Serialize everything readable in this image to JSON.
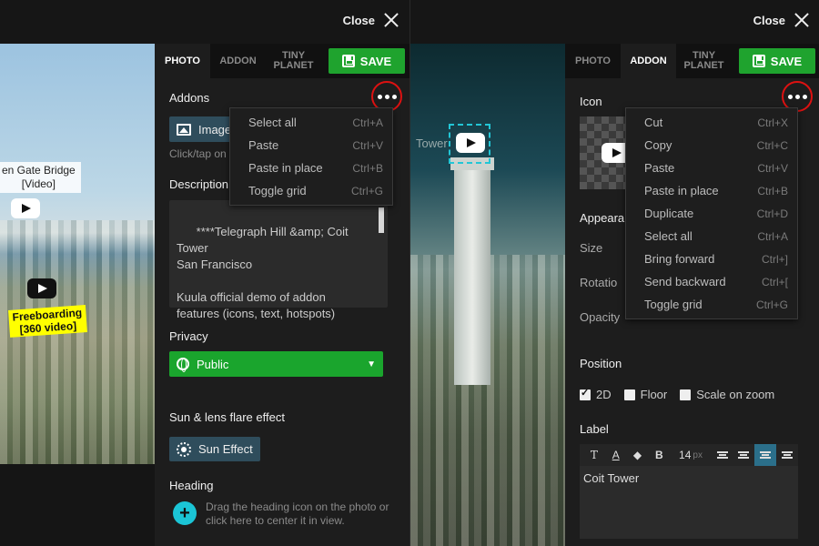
{
  "common": {
    "close_label": "Close",
    "save_label": "SAVE",
    "tabs": [
      "PHOTO",
      "ADDON",
      "TINY PLANET"
    ]
  },
  "left": {
    "photo": {
      "label_bridge": "en Gate Bridge\n[Video]",
      "label_freeboarding": "Freeboarding\n[360 video]"
    },
    "panel": {
      "addons_title": "Addons",
      "image_button": "Image",
      "addons_hint": "Click/tap on",
      "description_title": "Description",
      "description_text": "****Telegraph Hill &amp; Coit Tower\nSan Francisco\n\nKuula official demo of addon\nfeatures (icons, text, hotspots)",
      "privacy_title": "Privacy",
      "privacy_value": "Public",
      "sun_title": "Sun & lens flare effect",
      "sun_button": "Sun Effect",
      "heading_title": "Heading",
      "heading_hint": "Drag the heading icon on the photo or click here to center it in view."
    },
    "menu": [
      {
        "label": "Select all",
        "shortcut": "Ctrl+A"
      },
      {
        "label": "Paste",
        "shortcut": "Ctrl+V"
      },
      {
        "label": "Paste in place",
        "shortcut": "Ctrl+B"
      },
      {
        "label": "Toggle grid",
        "shortcut": "Ctrl+G"
      }
    ]
  },
  "right": {
    "photo": {
      "label_tower": "Tower"
    },
    "panel": {
      "icon_title": "Icon",
      "appearance_title": "Appeara",
      "size_label": "Size",
      "rotation_label": "Rotatio",
      "opacity_label": "Opacity",
      "position_title": "Position",
      "pos_2d": "2D",
      "pos_floor": "Floor",
      "pos_scale": "Scale on zoom",
      "label_title": "Label",
      "font_size": "14",
      "font_unit": "px",
      "label_text": "Coit Tower"
    },
    "menu": [
      {
        "label": "Cut",
        "shortcut": "Ctrl+X"
      },
      {
        "label": "Copy",
        "shortcut": "Ctrl+C"
      },
      {
        "label": "Paste",
        "shortcut": "Ctrl+V"
      },
      {
        "label": "Paste in place",
        "shortcut": "Ctrl+B"
      },
      {
        "label": "Duplicate",
        "shortcut": "Ctrl+D"
      },
      {
        "label": "Select all",
        "shortcut": "Ctrl+A"
      },
      {
        "label": "Bring forward",
        "shortcut": "Ctrl+]"
      },
      {
        "label": "Send backward",
        "shortcut": "Ctrl+["
      },
      {
        "label": "Toggle grid",
        "shortcut": "Ctrl+G"
      }
    ]
  },
  "colors": {
    "save_green": "#1fa32e",
    "privacy_green": "#1aa52d",
    "accent_cyan": "#1bc5d6",
    "highlight_red": "#dd1111"
  }
}
